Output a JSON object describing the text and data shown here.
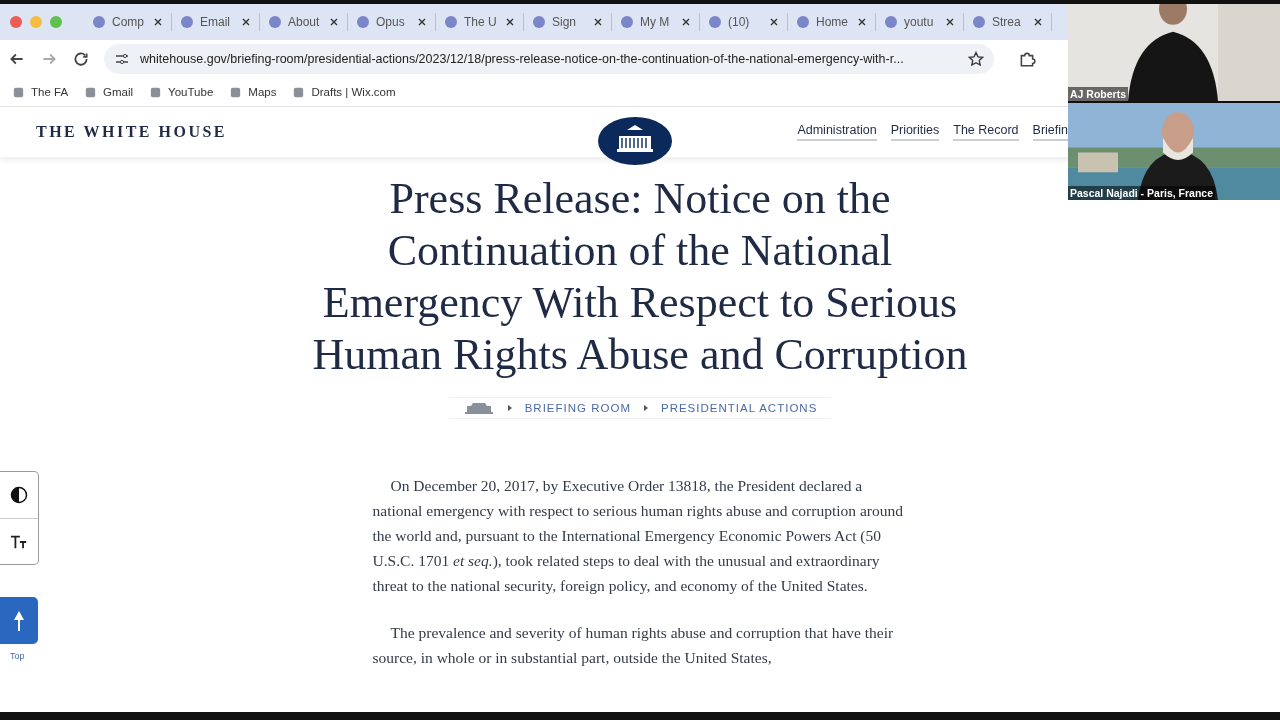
{
  "browser": {
    "tabs": [
      {
        "title": "Comp"
      },
      {
        "title": "Email"
      },
      {
        "title": "About"
      },
      {
        "title": "Opus"
      },
      {
        "title": "The U"
      },
      {
        "title": "Sign"
      },
      {
        "title": "My M"
      },
      {
        "title": "(10)"
      },
      {
        "title": "Home"
      },
      {
        "title": "youtu"
      },
      {
        "title": "Strea"
      }
    ],
    "url": "whitehouse.gov/briefing-room/presidential-actions/2023/12/18/press-release-notice-on-the-continuation-of-the-national-emergency-with-r...",
    "bookmarks": [
      "The FA",
      "Gmail",
      "YouTube",
      "Maps",
      "Drafts | Wix.com"
    ]
  },
  "site": {
    "name": "THE WHITE HOUSE",
    "nav": [
      "Administration",
      "Priorities",
      "The Record",
      "Briefin"
    ]
  },
  "article": {
    "title": "Press Release: Notice on the Continuation of the National Emergency With Respect to Serious Human Rights Abuse and Corruption",
    "breadcrumb": [
      "BRIEFING ROOM",
      "PRESIDENTIAL ACTIONS"
    ],
    "paragraphs": [
      "On December 20, 2017, by Executive Order 13818, the President declared a national emergency with respect to serious human rights abuse and corruption around the world and, pursuant to the International Emergency Economic Powers Act (50 U.S.C. 1701 *et seq.*), took related steps to deal with the unusual and extraordinary threat to the national security, foreign policy, and economy of the United States.",
      "The prevalence and severity of human rights abuse and corruption that have their source, in whole or in substantial part, outside the United States,"
    ]
  },
  "tools": {
    "top_label": "Top"
  },
  "video_call": [
    {
      "name": "AJ Roberts"
    },
    {
      "name": "Pascal Najadi  - Paris, France"
    }
  ]
}
